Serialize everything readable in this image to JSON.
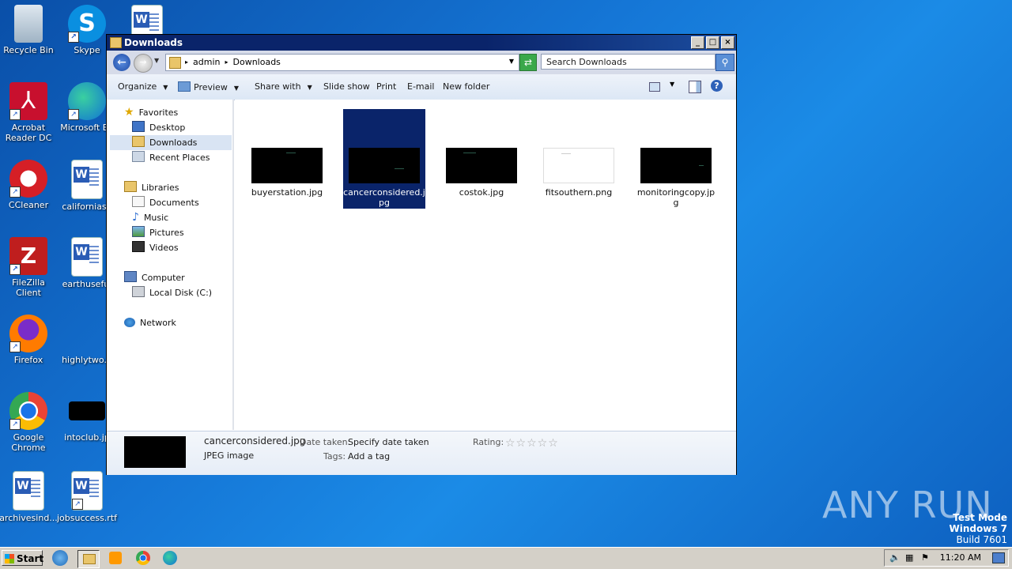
{
  "desktop": {
    "icons": [
      {
        "label": "Recycle Bin",
        "icon": "recycle-bin-icon"
      },
      {
        "label": "Skype",
        "icon": "skype-icon"
      },
      {
        "label": "",
        "icon": "word-document-icon"
      },
      {
        "label": "Acrobat Reader DC",
        "icon": "acrobat-icon"
      },
      {
        "label": "Microsoft Ed",
        "icon": "edge-icon"
      },
      {
        "label": "CCleaner",
        "icon": "ccleaner-icon"
      },
      {
        "label": "californiasp",
        "icon": "word-document-icon"
      },
      {
        "label": "FileZilla Client",
        "icon": "filezilla-icon"
      },
      {
        "label": "earthuseful",
        "icon": "word-document-icon"
      },
      {
        "label": "Firefox",
        "icon": "firefox-icon"
      },
      {
        "label": "highlytwo.p",
        "icon": "image-file-icon"
      },
      {
        "label": "Google Chrome",
        "icon": "chrome-icon"
      },
      {
        "label": "intoclub.jp",
        "icon": "image-file-icon"
      },
      {
        "label": "archivesind...",
        "icon": "word-document-icon"
      },
      {
        "label": "jobsuccess.rtf",
        "icon": "word-document-icon"
      }
    ]
  },
  "window": {
    "title": "Downloads",
    "breadcrumb": [
      "admin",
      "Downloads"
    ],
    "search_placeholder": "Search Downloads",
    "toolbar": {
      "organize": "Organize",
      "preview": "Preview",
      "share_with": "Share with",
      "slide_show": "Slide show",
      "print": "Print",
      "email": "E-mail",
      "new_folder": "New folder"
    },
    "nav": {
      "favorites": "Favorites",
      "desktop": "Desktop",
      "downloads": "Downloads",
      "recent_places": "Recent Places",
      "libraries": "Libraries",
      "documents": "Documents",
      "music": "Music",
      "pictures": "Pictures",
      "videos": "Videos",
      "computer": "Computer",
      "local_disk": "Local Disk (C:)",
      "network": "Network"
    },
    "files": [
      {
        "name": "buyerstation.jpg",
        "selected": false,
        "thumb": "black"
      },
      {
        "name": "cancerconsidered.jpg",
        "selected": true,
        "thumb": "black"
      },
      {
        "name": "costok.jpg",
        "selected": false,
        "thumb": "black"
      },
      {
        "name": "fitsouthern.png",
        "selected": false,
        "thumb": "white"
      },
      {
        "name": "monitoringcopy.jpg",
        "selected": false,
        "thumb": "black"
      }
    ],
    "details": {
      "filename": "cancerconsidered.jpg",
      "filetype": "JPEG image",
      "date_label": "Date taken:",
      "date_value": "Specify date taken",
      "tags_label": "Tags:",
      "tags_value": "Add a tag",
      "rating_label": "Rating:",
      "rating_value": 0
    }
  },
  "taskbar": {
    "start_label": "Start",
    "clock": "11:20 AM"
  },
  "watermark": "ANY RUN",
  "system_info": {
    "test_mode": "Test Mode",
    "os": "Windows 7",
    "build": "Build 7601"
  },
  "colors": {
    "selection": "#0a246a",
    "titlebar": "#0a246a",
    "desktop_blue": "#1576d6"
  }
}
